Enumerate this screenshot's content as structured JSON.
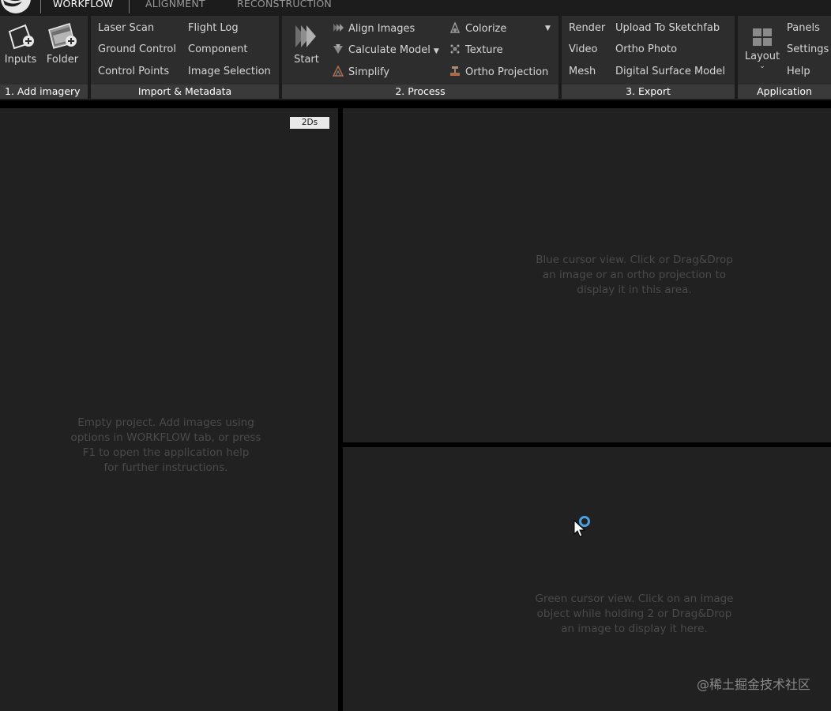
{
  "colors": {
    "background": "#000000",
    "panel": "#212121",
    "ribbon_group": "#2d2d2d",
    "group_footer": "#3a3a3a",
    "cursor_accent": "#4aa0e0"
  },
  "tabs": [
    "WORKFLOW",
    "ALIGNMENT",
    "RECONSTRUCTION"
  ],
  "active_tab": "WORKFLOW",
  "ribbon": {
    "add_imagery": {
      "title": "1. Add imagery",
      "inputs_label": "Inputs",
      "folder_label": "Folder",
      "inputs_icon": "add-image-icon",
      "folder_icon": "add-folder-icon"
    },
    "import_metadata": {
      "title": "Import & Metadata",
      "items": [
        "Laser Scan",
        "Ground Control",
        "Control Points",
        "Flight Log",
        "Component",
        "Image Selection"
      ]
    },
    "process": {
      "title": "2. Process",
      "start_label": "Start",
      "items": [
        "Align Images",
        "Calculate Model",
        "Simplify",
        "Colorize",
        "Texture",
        "Ortho Projection"
      ]
    },
    "export": {
      "title": "3. Export",
      "items": [
        "Render",
        "Video",
        "Mesh",
        "Upload To Sketchfab",
        "Ortho Photo",
        "Digital Surface Model"
      ]
    },
    "application": {
      "title": "Application",
      "layout_label": "Layout",
      "items": [
        "Panels",
        "Settings",
        "Help"
      ]
    }
  },
  "panels": {
    "left": {
      "badge": "2Ds",
      "hint_lines": [
        "Empty project. Add images using",
        "options in WORKFLOW tab, or press",
        "F1 to open the application help",
        "for further instructions."
      ]
    },
    "blue": {
      "hint_lines": [
        "Blue cursor view. Click or Drag&Drop",
        "an image or an ortho projection to",
        "display it in this area."
      ]
    },
    "green": {
      "hint_lines": [
        "Green cursor view. Click on an image",
        "object while holding 2 or Drag&Drop",
        "an image to display it here."
      ]
    }
  },
  "watermark": "@稀土掘金技术社区"
}
